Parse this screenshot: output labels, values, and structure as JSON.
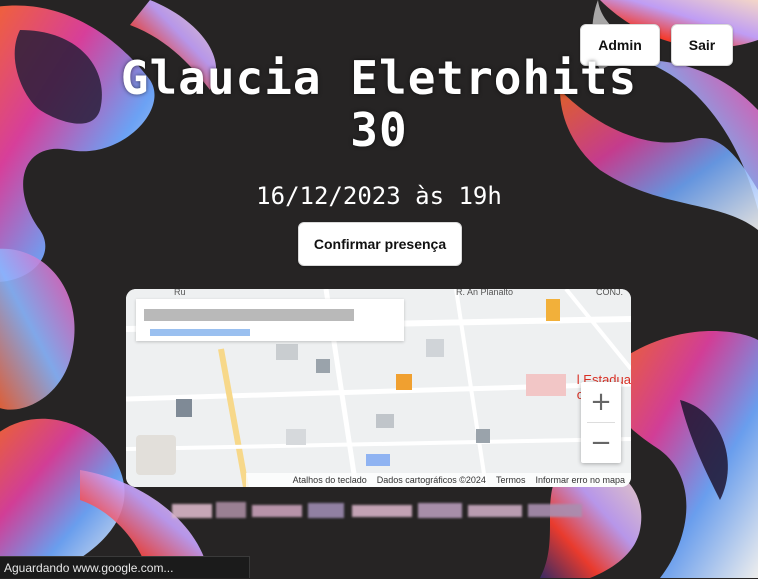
{
  "header": {
    "admin_label": "Admin",
    "logout_label": "Sair"
  },
  "event": {
    "title_line1": "Glaucia Eletrohits",
    "title_line2": "30",
    "date_text": "16/12/2023 às 19h",
    "confirm_label": "Confirmar presença"
  },
  "map": {
    "label_street_top": "R. An",
    "label_planalto": "Planalto",
    "label_conj": "CONJ.",
    "label_ru": "Ru",
    "label_estadual": "l Estadua",
    "label_estadual_2": "o.",
    "zoom_in": "+",
    "zoom_out": "−",
    "attribution": {
      "shortcuts": "Atalhos do teclado",
      "data": "Dados cartográficos ©2024",
      "terms": "Termos",
      "report": "Informar erro no mapa"
    }
  },
  "status_bar": {
    "text": "Aguardando www.google.com..."
  },
  "colors": {
    "background": "#262424",
    "button_bg": "#ffffff",
    "title_text": "#ffffff",
    "map_red_label": "#d93025"
  }
}
